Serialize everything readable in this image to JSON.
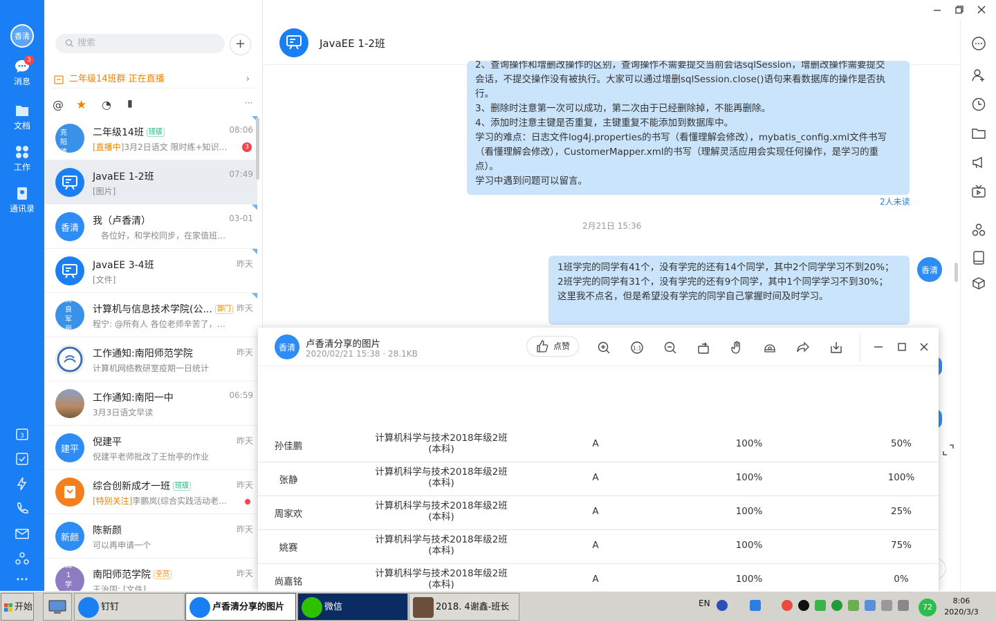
{
  "nav": {
    "avatar_text": "香清",
    "items": [
      {
        "label": "消息",
        "badge": "3"
      },
      {
        "label": "文档"
      },
      {
        "label": "工作"
      },
      {
        "label": "通讯录"
      }
    ]
  },
  "list": {
    "search_placeholder": "搜索",
    "add": "+",
    "live_banner": "二年级14班群 正在直播",
    "filters": [
      "@",
      "★",
      "◔",
      "▮",
      "···"
    ],
    "conversations": [
      {
        "name": "二年级14班",
        "tag": "班级",
        "time": "08:06",
        "highlight": "[直播中]",
        "msg": "3月2日语文 限时练+知识清单",
        "badge": "3",
        "avatar_text": "克阳清松"
      },
      {
        "name": "JavaEE 1-2班",
        "time": "07:49",
        "msg": "[图片]"
      },
      {
        "name": "我（卢香清）",
        "time": "03-01",
        "msg": "各位好，和学校同步，在家值班接...",
        "avatar_text": "香清"
      },
      {
        "name": "JavaEE 3-4班",
        "time": "昨天",
        "msg": "[文件]"
      },
      {
        "name": "计算机与信息技术学院(公...",
        "tag": "部门",
        "time": "昨天",
        "msg": "程宁: @所有人 各位老师辛苦了，网...",
        "avatar_text": "真良军丽"
      },
      {
        "name": "工作通知:南阳师范学院",
        "time": "昨天",
        "msg": "计算机网络教研室疫期一日统计"
      },
      {
        "name": "工作通知:南阳一中",
        "time": "06:59",
        "msg": "3月3日语文早读"
      },
      {
        "name": "倪建平",
        "time": "昨天",
        "msg": "倪建平老师批改了王怡亭的作业",
        "avatar_text": "建平"
      },
      {
        "name": "综合创新成才一班",
        "tag": "班级",
        "time": "昨天",
        "highlight": "[特别关注]",
        "msg": "李鹏岚(综合实践活动老师)...",
        "avatar_text": ""
      },
      {
        "name": "陈新颜",
        "time": "昨天",
        "msg": "可以再申请一个",
        "avatar_text": "新颜"
      },
      {
        "name": "南阳师范学院",
        "tag": "全员",
        "time": "昨天",
        "msg": "王治国: [文件]",
        "avatar_text": "国1学哲"
      }
    ]
  },
  "chat": {
    "title": "JavaEE 1-2班",
    "msg1_lines": [
      "2、查询操作和增删改操作的区别，查询操作不需要提交当前会话sqlSession，增删改操作需要提交",
      "会话，不提交操作没有被执行。大家可以通过增删sqlSession.close()语句来看数据库的操作是否执",
      "行。",
      "3、删除时注意第一次可以成功，第二次由于已经删除掉，不能再删除。",
      "4、添加时注意主键是否重复，主键重复不能添加到数据库中。",
      "学习的难点：日志文件log4j.properties的书写（看懂理解会修改），mybatis_config.xml文件书写",
      "（看懂理解会修改），CustomerMapper.xml的书写（理解灵活应用会实现任何操作，是学习的重",
      "点）。",
      "学习中遇到问题可以留言。"
    ],
    "msg1_read": "2人未读",
    "timestamp": "2月21日 15:36",
    "msg2_lines": [
      "1班学完的同学有41个，没有学完的还有14个同学，其中2个同学学习不到20%；",
      "2班学完的同学有31个，没有学完的还有9个同学，其中1个同学学习不到30%；",
      "这里我不点名，但是希望没有学完的同学自己掌握时间及时学习。"
    ],
    "sender_avatar": "香清"
  },
  "viewer": {
    "avatar_text": "香清",
    "title": "卢香清分享的图片",
    "subtitle": "2020/02/21 15:38 · 28.1KB",
    "like_label": "点赞",
    "tools": [
      "zoom-in-icon",
      "actual-size-icon",
      "zoom-out-icon",
      "rotate-icon",
      "hand-icon",
      "ocr-icon",
      "share-icon",
      "download-icon"
    ],
    "rows": [
      {
        "name": "孙佳鹏",
        "class_line1": "计算机科学与技术2018年级2班",
        "class_line2": "(本科)",
        "grade": "A",
        "p1": "100%",
        "p2": "50%"
      },
      {
        "name": "张静",
        "class_line1": "计算机科学与技术2018年级2班",
        "class_line2": "(本科)",
        "grade": "A",
        "p1": "100%",
        "p2": "100%"
      },
      {
        "name": "周家欢",
        "class_line1": "计算机科学与技术2018年级2班",
        "class_line2": "(本科)",
        "grade": "A",
        "p1": "100%",
        "p2": "25%"
      },
      {
        "name": "姚赛",
        "class_line1": "计算机科学与技术2018年级2班",
        "class_line2": "(本科)",
        "grade": "A",
        "p1": "100%",
        "p2": "75%"
      },
      {
        "name": "尚嘉铭",
        "class_line1": "计算机科学与技术2018年级2班",
        "class_line2": "(本科)",
        "grade": "A",
        "p1": "100%",
        "p2": "0%"
      }
    ]
  },
  "taskbar": {
    "start": "开始",
    "buttons": [
      {
        "label": "钉钉"
      },
      {
        "label": "卢香清分享的图片"
      },
      {
        "label": "微信"
      },
      {
        "label": "2018. 4谢鑫-班长"
      }
    ],
    "lang": "EN",
    "tray_badge": "72",
    "time": "8:06",
    "date": "2020/3/3"
  }
}
